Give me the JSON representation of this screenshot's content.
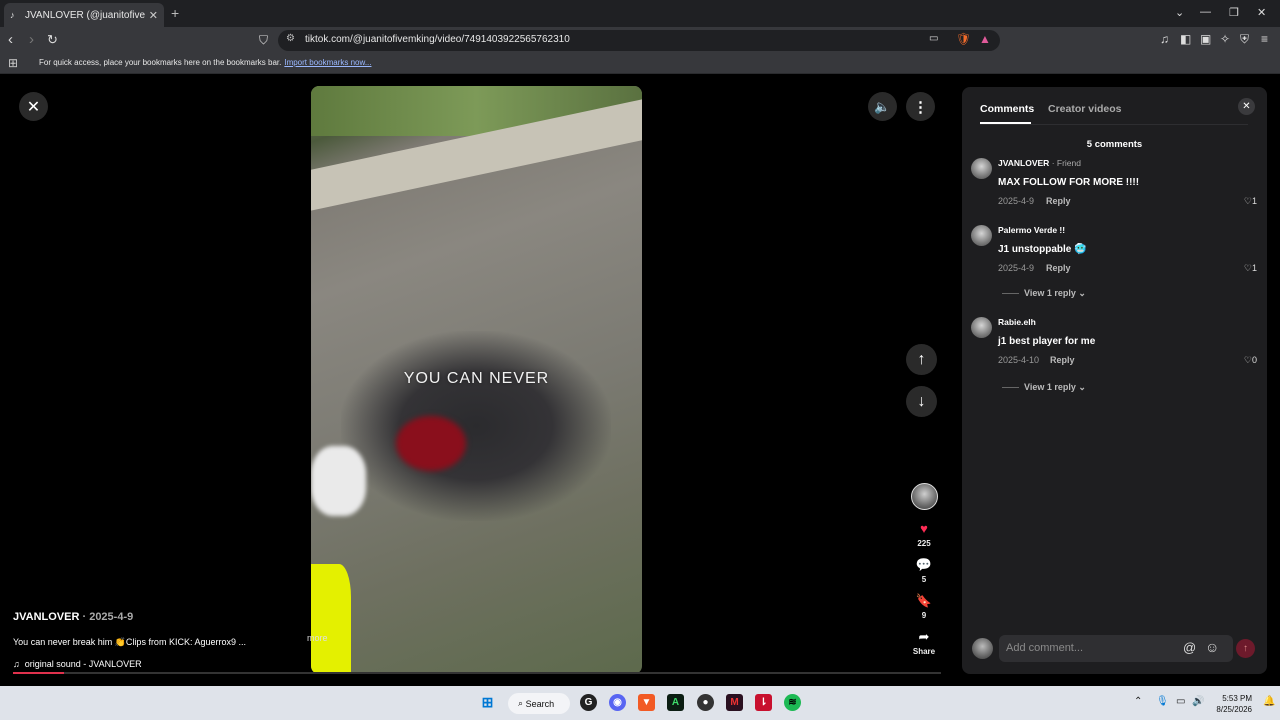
{
  "browser": {
    "tab_title": "JVANLOVER (@juanitofivemking",
    "url": "tiktok.com/@juanitofivemking/video/7491403922565762310",
    "bookmarks_hint": "For quick access, place your bookmarks here on the bookmarks bar.",
    "bookmarks_link": "Import bookmarks now..."
  },
  "video": {
    "overlay_text": "YOU  CAN  NEVER",
    "author": "JVANLOVER",
    "date": " · 2025-4-9",
    "description": "You can never break him 👏Clips from KICK: Aguerrox9 ...",
    "more_label": "more",
    "sound": "original sound - JVANLOVER",
    "likes": "225",
    "comments": "5",
    "saves": "9",
    "share_label": "Share",
    "progress": 0.055
  },
  "panel": {
    "tab_comments": "Comments",
    "tab_creator": "Creator videos",
    "comment_count": "5 comments",
    "comments": [
      {
        "name": "JVANLOVER",
        "tag": " · Friend",
        "text": "MAX FOLLOW FOR MORE !!!!",
        "date": "2025-4-9",
        "reply": "Reply",
        "likes": "1"
      },
      {
        "name": "Palermo Verde !!",
        "tag": "",
        "text": "J1 unstoppable 🥶",
        "date": "2025-4-9",
        "reply": "Reply",
        "likes": "1",
        "view_replies": "View 1 reply"
      },
      {
        "name": "Rabie.elh",
        "tag": "",
        "text": "j1 best player for me",
        "date": "2025-4-10",
        "reply": "Reply",
        "likes": "0",
        "view_replies": "View 1 reply"
      }
    ],
    "input_placeholder": "Add comment..."
  },
  "taskbar": {
    "search_label": "Search",
    "time": "5:53 PM",
    "date": "8/25/2026"
  },
  "colors": {
    "accent": "#e0314d",
    "like_heart": "#fe2c55"
  }
}
